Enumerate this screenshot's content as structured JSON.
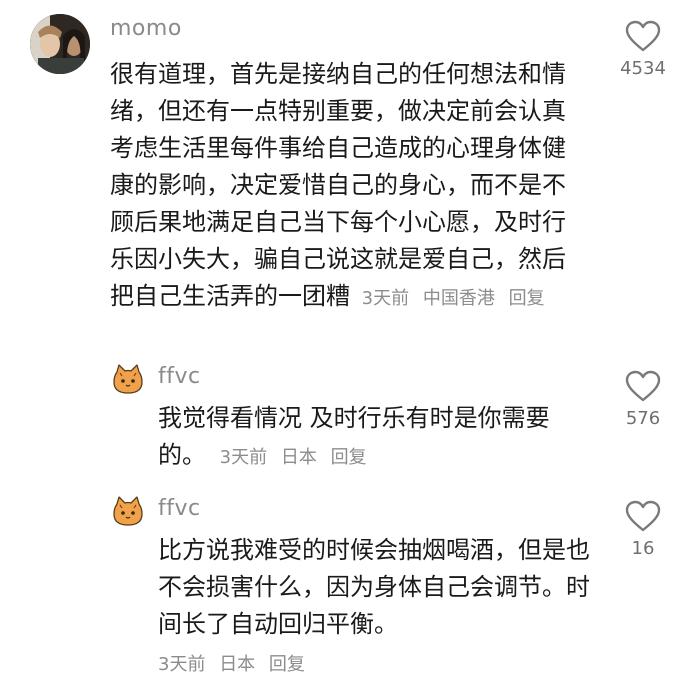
{
  "comments": [
    {
      "username": "momo",
      "text": "很有道理，首先是接纳自己的任何想法和情绪，但还有一点特别重要，做决定前会认真考虑生活里每件事给自己造成的心理身体健康的影响，决定爱惜自己的身心，而不是不顾后果地满足自己当下每个小心愿，及时行乐因小失大，骗自己说这就是爱自己，然后把自己生活弄的一团糟",
      "time": "3天前",
      "location": "中国香港",
      "reply_label": "回复",
      "like_count": "4534",
      "avatar_icon": "user-photo-avatar"
    },
    {
      "username": "ffvc",
      "text": "我觉得看情况 及时行乐有时是你需要的。",
      "time": "3天前",
      "location": "日本",
      "reply_label": "回复",
      "like_count": "576",
      "avatar_icon": "cat-avatar"
    },
    {
      "username": "ffvc",
      "text": "比方说我难受的时候会抽烟喝酒，但是也不会损害什么，因为身体自己会调节。时间长了自动回归平衡。",
      "time": "3天前",
      "location": "日本",
      "reply_label": "回复",
      "like_count": "16",
      "avatar_icon": "cat-avatar"
    }
  ],
  "colors": {
    "username": "#8a8a8a",
    "body_text": "#1a1a1a",
    "meta": "#8c8c8c",
    "heart_outline": "#7a7a7a",
    "cat_orange": "#f0a24a"
  }
}
